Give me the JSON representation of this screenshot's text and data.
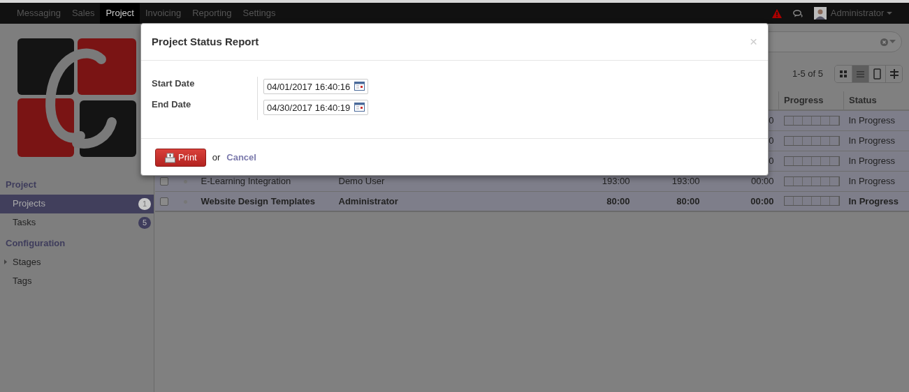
{
  "navbar": {
    "menu": [
      {
        "label": "Messaging",
        "selected": false
      },
      {
        "label": "Sales",
        "selected": false
      },
      {
        "label": "Project",
        "selected": true
      },
      {
        "label": "Invoicing",
        "selected": false
      },
      {
        "label": "Reporting",
        "selected": false
      },
      {
        "label": "Settings",
        "selected": false
      }
    ],
    "user": "Administrator"
  },
  "sidebar": {
    "sections": [
      {
        "title": "Project",
        "items": [
          {
            "label": "Projects",
            "count": "1",
            "selected": true,
            "expandable": false
          },
          {
            "label": "Tasks",
            "count": "5",
            "selected": false,
            "expandable": false
          }
        ]
      },
      {
        "title": "Configuration",
        "items": [
          {
            "label": "Stages",
            "selected": false,
            "expandable": true
          },
          {
            "label": "Tags",
            "selected": false,
            "expandable": false
          }
        ]
      }
    ]
  },
  "pager": "1-5 of 5",
  "view_switcher": [
    {
      "kind": "kanban",
      "selected": false
    },
    {
      "kind": "list",
      "selected": true
    },
    {
      "kind": "form",
      "selected": false
    },
    {
      "kind": "gantt",
      "selected": false
    }
  ],
  "table": {
    "columns": [
      "Progress",
      "Status"
    ],
    "rows": [
      {
        "column_5": "0",
        "level": 0,
        "status": "In Progress",
        "bold": false
      },
      {
        "column_5": "0",
        "level": 0,
        "status": "In Progress",
        "bold": false
      },
      {
        "column_5": "0",
        "level": 0,
        "status": "In Progress",
        "bold": false
      },
      {
        "checked": false,
        "name": "E-Learning Integration",
        "manager": "Demo User",
        "column_3": "193:00",
        "column_4": "193:00",
        "column_5": "00:00",
        "level": 0,
        "status": "In Progress",
        "bold": false
      },
      {
        "checked": false,
        "name": "Website Design Templates",
        "manager": "Administrator",
        "column_3": "80:00",
        "column_4": "80:00",
        "column_5": "00:00",
        "level": 0,
        "status": "In Progress",
        "bold": true
      }
    ]
  },
  "dialog": {
    "title": "Project Status Report",
    "close": "×",
    "fields": [
      {
        "label": "Start Date",
        "value": "04/01/2017 16:40:16"
      },
      {
        "label": "End Date",
        "value": "04/30/2017 16:40:19"
      }
    ],
    "print": "Print",
    "or": "or",
    "cancel": "Cancel"
  }
}
